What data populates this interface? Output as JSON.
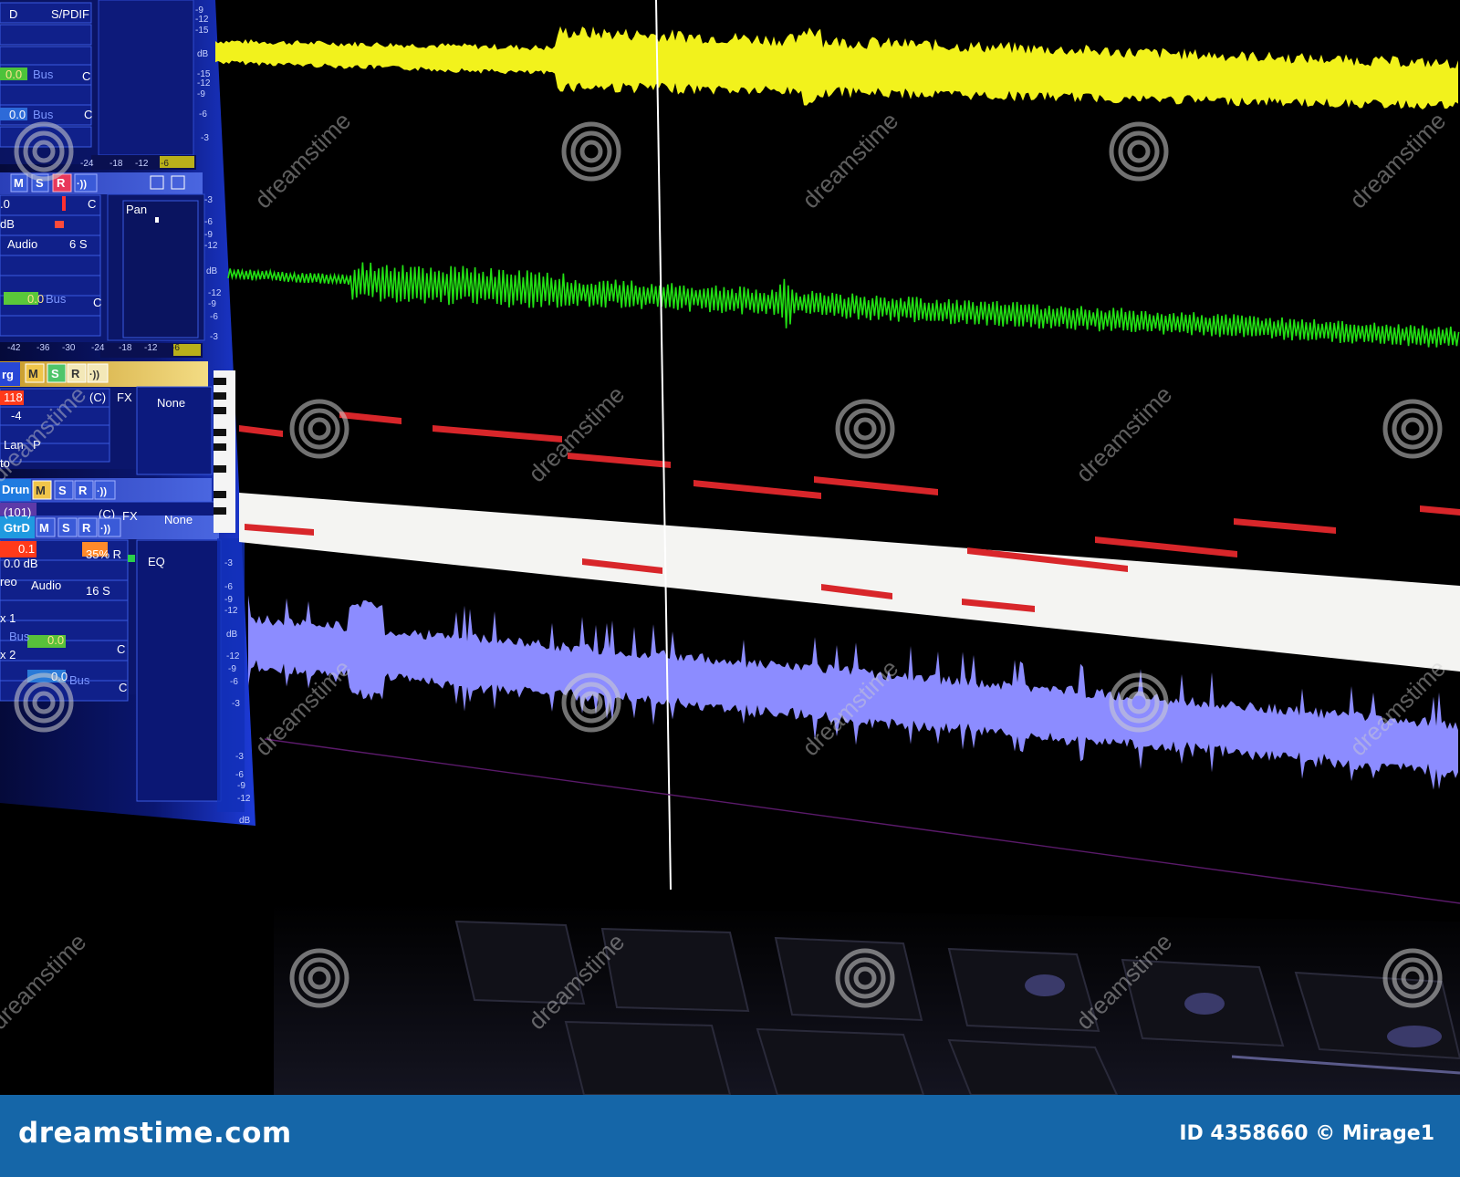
{
  "mixer": {
    "strip1": {
      "input": "D",
      "output": "S/PDIF",
      "send1_value": "0.0",
      "send1_bus": "Bus",
      "send1_pan": "C",
      "send2_value": "0.0",
      "send2_bus": "Bus",
      "send2_pan": "C",
      "meter_scale": [
        "-9",
        "-12",
        "-15",
        "dB",
        "-15",
        "-12",
        "-9",
        "-6",
        "-3"
      ],
      "bottom_scale": [
        "-24",
        "-18",
        "-12",
        "-6"
      ]
    },
    "strip2": {
      "buttons": [
        "M",
        "S",
        "R",
        "·))"
      ],
      "volume": ".0",
      "pan": "C",
      "gain": "dB",
      "type": "Audio",
      "mode": "6 S",
      "send_value": "0.0",
      "send_bus": "Bus",
      "send_pan": "C",
      "pan_label": "Pan",
      "meter_scale": [
        "-3",
        "-6",
        "-9",
        "-12",
        "dB",
        "-12",
        "-9",
        "-6",
        "-3"
      ],
      "bottom_scale": [
        "-42",
        "-36",
        "-30",
        "-24",
        "-18",
        "-12",
        "-6"
      ]
    },
    "strip3": {
      "name": "rg",
      "buttons": [
        "M",
        "S",
        "R",
        "·))"
      ],
      "volume": "118",
      "pan": "-4",
      "fx_label": "FX",
      "fx_value": "None",
      "c_label": "(C)",
      "lane": "Lan",
      "lane_mode": "P",
      "row3": "to"
    },
    "strip4": {
      "name": "Drun",
      "buttons": [
        "M",
        "S",
        "R",
        "·))"
      ],
      "patch": "(101)",
      "c_label": "(C)",
      "fx_label": "FX",
      "fx_value": "None"
    },
    "strip5": {
      "name": "GtrD",
      "buttons": [
        "M",
        "S",
        "R",
        "·))"
      ],
      "volume": "0.1",
      "pan": "35% R",
      "gain": "0.0 dB",
      "type_left": "reo",
      "type": "Audio",
      "mode": "16 S",
      "row_a": "x 1",
      "send1_value": "0.0",
      "send1_bus": "Bus",
      "send1_pan": "C",
      "row_b": "x 2",
      "send2_value": "0.0",
      "send2_bus": "Bus",
      "send2_pan": "C",
      "eq_label": "EQ",
      "meter_scale": [
        "-3",
        "-6",
        "-9",
        "-12",
        "dB",
        "-12",
        "-9",
        "-6",
        "-3",
        "-3",
        "-6",
        "-9",
        "-12",
        "dB"
      ]
    }
  },
  "tracks": {
    "audio1_color": "#f2f21c",
    "audio2_color": "#22e014",
    "midi_note_color": "#d8262a",
    "audio3_color": "#8c8cff",
    "now_line_color": "#ffffff"
  },
  "watermark": {
    "text": "dreamstime"
  },
  "footer": {
    "site": "dreamstime.com",
    "credit": "ID 4358660 © Mirage1"
  }
}
